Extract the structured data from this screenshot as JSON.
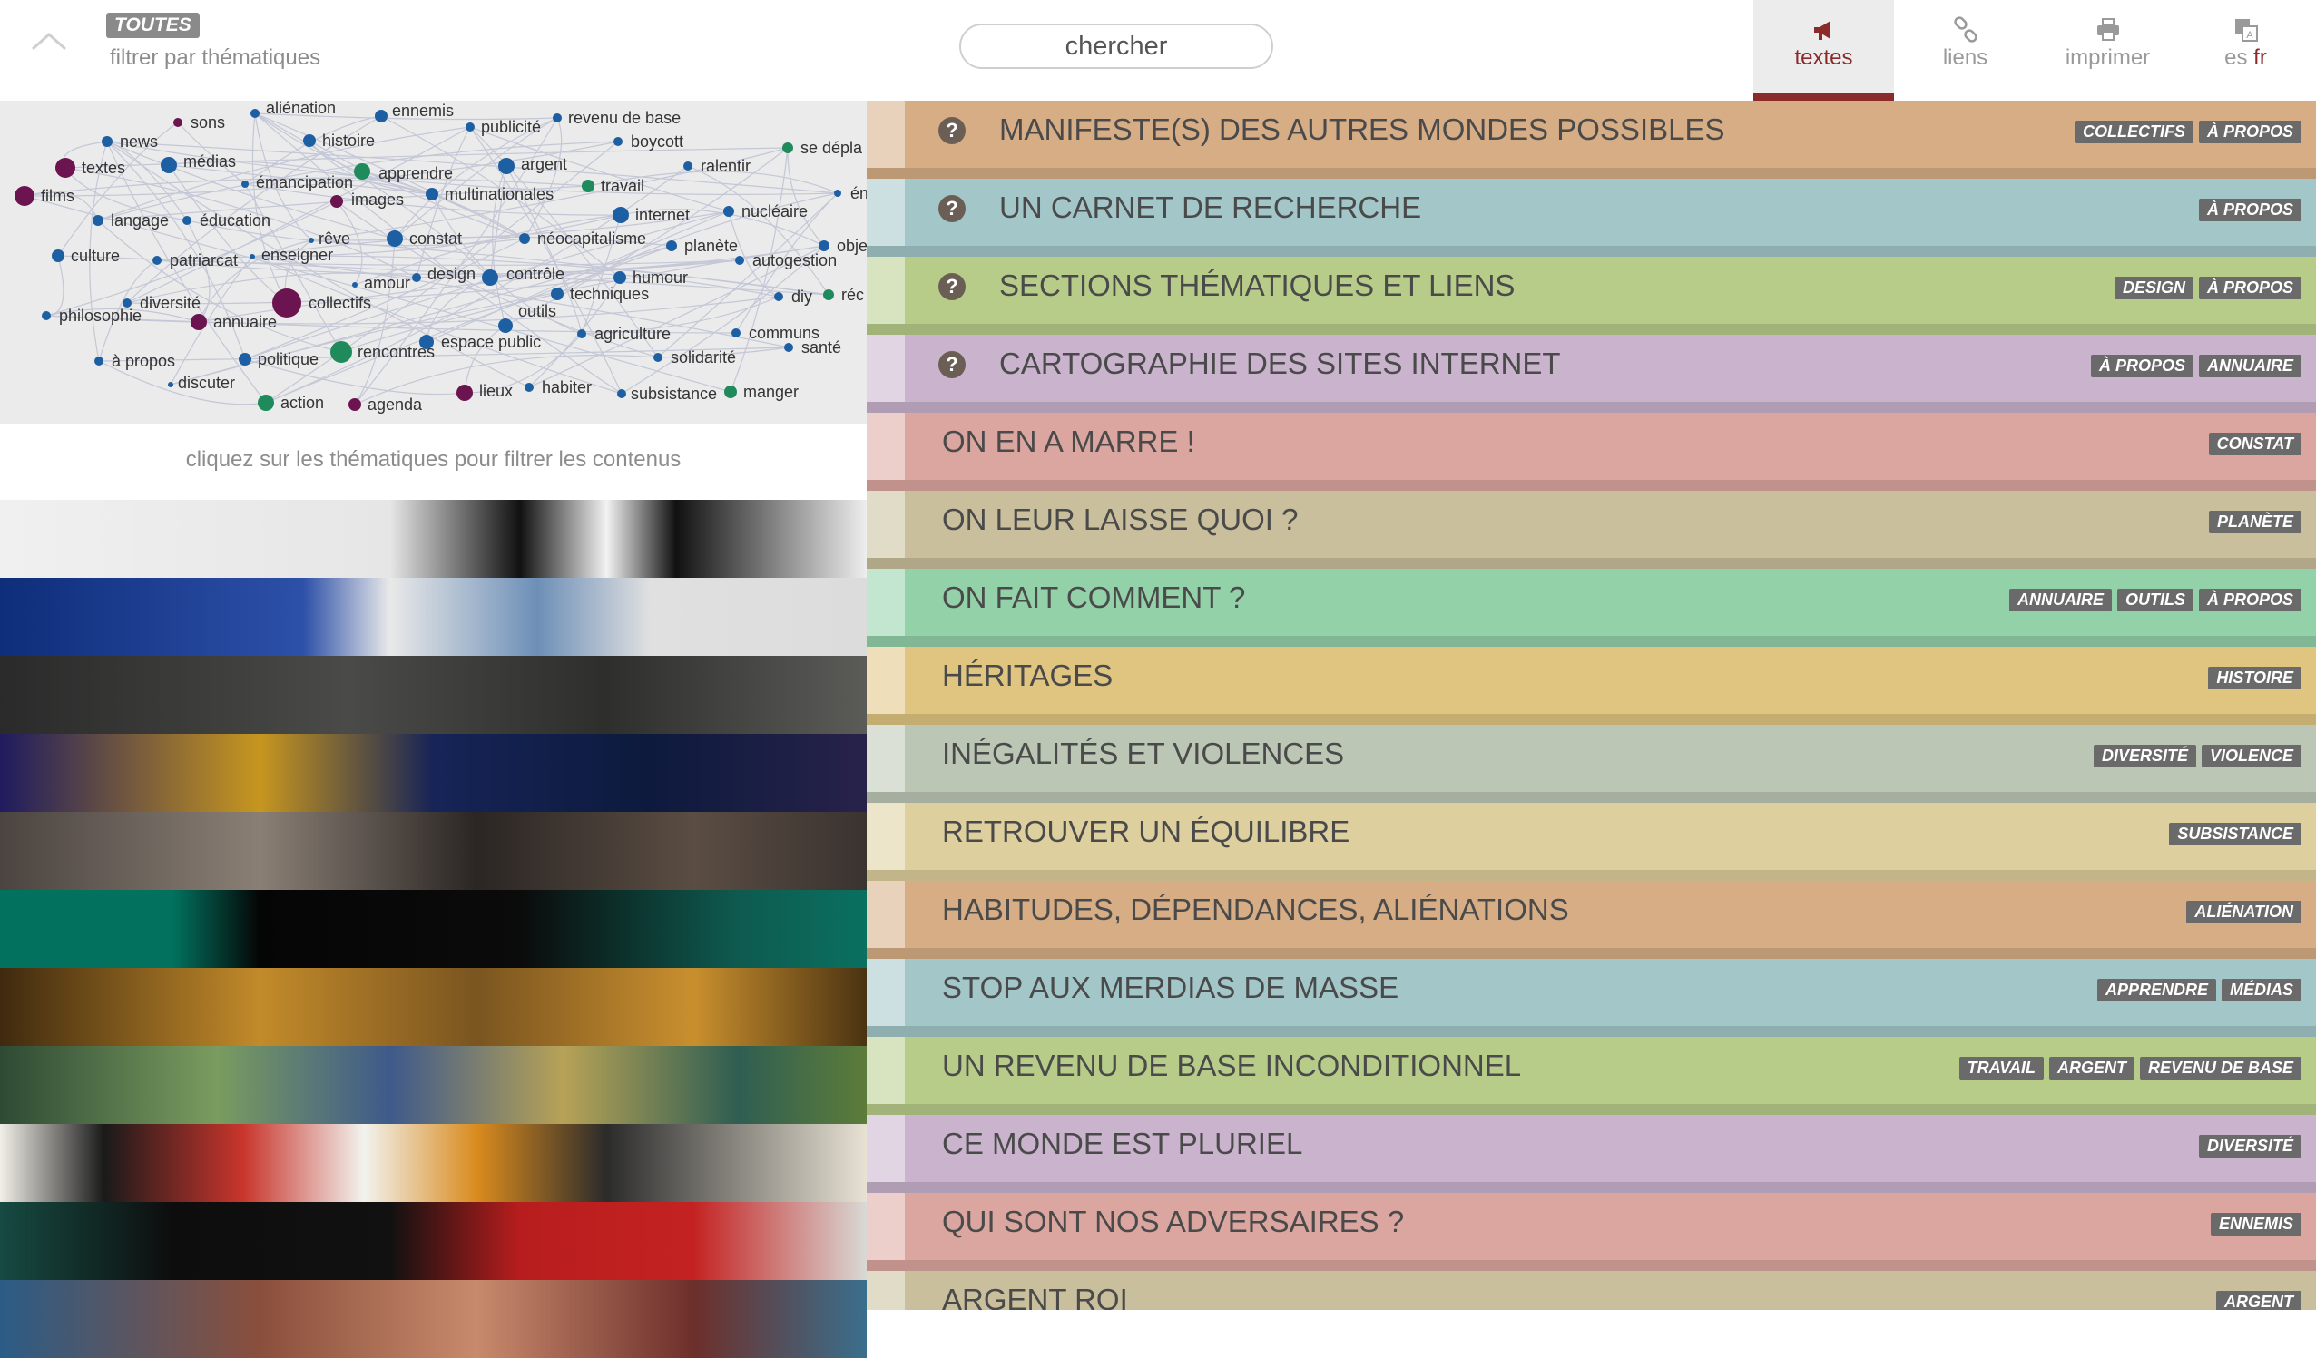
{
  "header": {
    "toutes": "TOUTES",
    "filter_label": "filtrer par thématiques",
    "search_placeholder": "chercher",
    "nav": {
      "textes": "textes",
      "liens": "liens",
      "imprimer": "imprimer",
      "lang_es": "es",
      "lang_fr": "fr"
    }
  },
  "map": {
    "nodes": [
      "sons",
      "aliénation",
      "ennemis",
      "publicité",
      "revenu de base",
      "news",
      "histoire",
      "boycott",
      "se dépla",
      "textes",
      "médias",
      "apprendre",
      "argent",
      "ralentir",
      "émancipation",
      "travail",
      "én",
      "films",
      "images",
      "multinationales",
      "nucléaire",
      "langage",
      "éducation",
      "internet",
      "rêve",
      "constat",
      "néocapitalisme",
      "planète",
      "obje",
      "culture",
      "patriarcat",
      "enseigner",
      "autogestion",
      "design",
      "contrôle",
      "humour",
      "amour",
      "diy",
      "réc",
      "diversité",
      "collectifs",
      "techniques",
      "philosophie",
      "annuaire",
      "outils",
      "agriculture",
      "communs",
      "espace public",
      "santé",
      "à propos",
      "politique",
      "rencontres",
      "solidarité",
      "discuter",
      "habiter",
      "action",
      "agenda",
      "lieux",
      "subsistance",
      "manger"
    ],
    "caption": "cliquez sur les thématiques pour filtrer les contenus"
  },
  "rows": [
    {
      "title": "MANIFESTE(S) DES AUTRES MONDES POSSIBLES",
      "help": true,
      "color": "#d6ad85",
      "tags": [
        "COLLECTIFS",
        "À PROPOS"
      ]
    },
    {
      "title": "UN CARNET DE RECHERCHE",
      "help": true,
      "color": "#a3c6c9",
      "tags": [
        "À PROPOS"
      ]
    },
    {
      "title": "SECTIONS THÉMATIQUES ET LIENS",
      "help": true,
      "color": "#b8cc8a",
      "tags": [
        "DESIGN",
        "À PROPOS"
      ]
    },
    {
      "title": "CARTOGRAPHIE DES SITES INTERNET",
      "help": true,
      "color": "#c9b3cd",
      "tags": [
        "À PROPOS",
        "ANNUAIRE"
      ]
    },
    {
      "title": "ON EN A MARRE !",
      "help": false,
      "color": "#dca6a0",
      "tags": [
        "CONSTAT"
      ]
    },
    {
      "title": "ON LEUR LAISSE QUOI ?",
      "help": false,
      "color": "#c9bf9c",
      "tags": [
        "PLANÈTE"
      ]
    },
    {
      "title": "ON FAIT COMMENT ?",
      "help": false,
      "color": "#93d1a9",
      "tags": [
        "ANNUAIRE",
        "OUTILS",
        "À PROPOS"
      ]
    },
    {
      "title": "HÉRITAGES",
      "help": false,
      "color": "#e0c581",
      "tags": [
        "HISTOIRE"
      ]
    },
    {
      "title": "INÉGALITÉS ET VIOLENCES",
      "help": false,
      "color": "#bcc6b5",
      "tags": [
        "DIVERSITÉ",
        "VIOLENCE"
      ]
    },
    {
      "title": "RETROUVER UN ÉQUILIBRE",
      "help": false,
      "color": "#ddcf9e",
      "tags": [
        "SUBSISTANCE"
      ]
    },
    {
      "title": "HABITUDES, DÉPENDANCES, ALIÉNATIONS",
      "help": false,
      "color": "#d6ad85",
      "tags": [
        "ALIÉNATION"
      ]
    },
    {
      "title": "STOP AUX MERDIAS DE MASSE",
      "help": false,
      "color": "#a3c6c9",
      "tags": [
        "APPRENDRE",
        "MÉDIAS"
      ]
    },
    {
      "title": "UN REVENU DE BASE INCONDITIONNEL",
      "help": false,
      "color": "#b8cc8a",
      "tags": [
        "TRAVAIL",
        "ARGENT",
        "REVENU DE BASE"
      ]
    },
    {
      "title": "CE MONDE EST PLURIEL",
      "help": false,
      "color": "#c9b3cd",
      "tags": [
        "DIVERSITÉ"
      ]
    },
    {
      "title": "QUI SONT NOS ADVERSAIRES ?",
      "help": false,
      "color": "#dca6a0",
      "tags": [
        "ENNEMIS"
      ]
    },
    {
      "title": "ARGENT ROI",
      "help": false,
      "color": "#c9bf9c",
      "tags": [
        "ARGENT"
      ]
    }
  ],
  "colors": {
    "accent": "#8a2a2a",
    "node_blue": "#1d5fa3",
    "node_purple": "#6b1450",
    "node_green": "#1f8a5c"
  }
}
